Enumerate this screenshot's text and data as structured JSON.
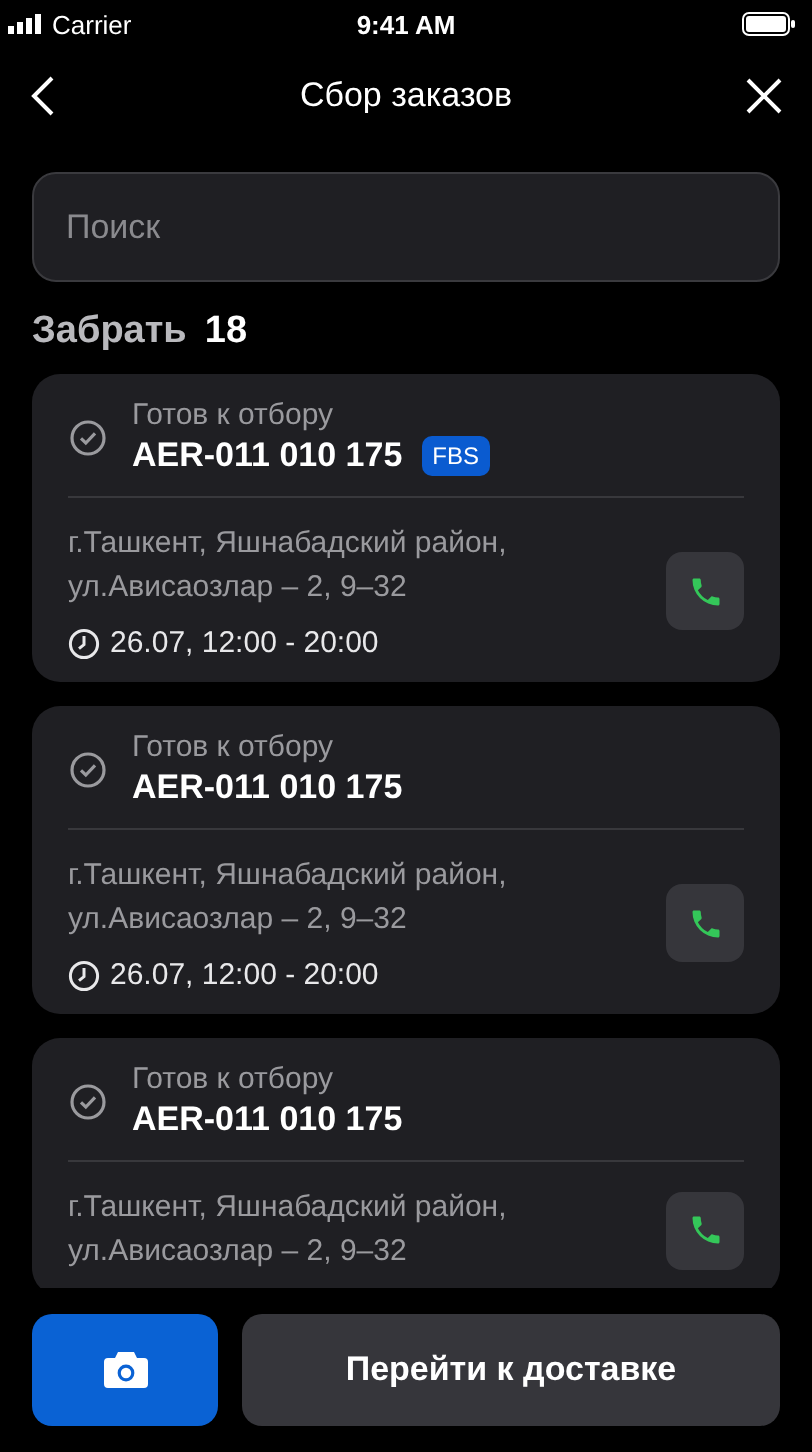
{
  "status_bar": {
    "carrier": "Carrier",
    "time": "9:41 AM"
  },
  "nav": {
    "title": "Сбор заказов"
  },
  "search": {
    "placeholder": "Поиск"
  },
  "section": {
    "label": "Забрать",
    "count": "18"
  },
  "orders": [
    {
      "status": "Готов к отбору",
      "number": "AER-011 010 175",
      "badge": "FBS",
      "address": "г.Ташкент, Яшнабадский район, ул.Ависаозлар – 2, 9–32",
      "time": "26.07, 12:00 - 20:00"
    },
    {
      "status": "Готов к отбору",
      "number": "AER-011 010 175",
      "address": "г.Ташкент, Яшнабадский район, ул.Ависаозлар – 2, 9–32",
      "time": "26.07, 12:00 - 20:00"
    },
    {
      "status": "Готов к отбору",
      "number": "AER-011 010 175",
      "address": "г.Ташкент, Яшнабадский район, ул.Ависаозлар – 2, 9–32"
    }
  ],
  "footer": {
    "primary_button": "Перейти к доставке"
  }
}
